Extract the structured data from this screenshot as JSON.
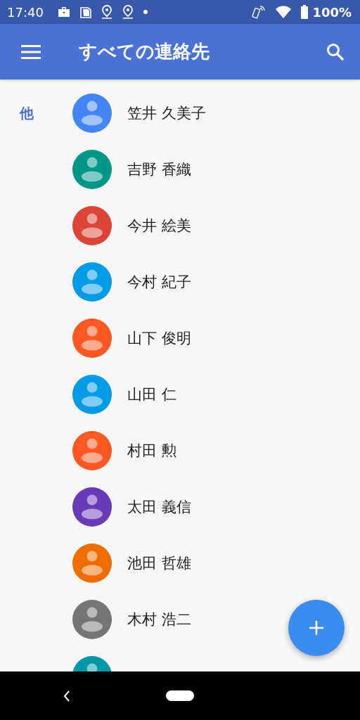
{
  "status_bar": {
    "time": "17:40",
    "battery": "100%"
  },
  "app_bar": {
    "title": "すべての連絡先"
  },
  "sections": [
    {
      "letter": "他",
      "contacts": [
        {
          "name": "笠井 久美子",
          "color": "#4285f4"
        },
        {
          "name": "吉野 香織",
          "color": "#009688"
        },
        {
          "name": "今井 絵美",
          "color": "#db4437"
        },
        {
          "name": "今村 紀子",
          "color": "#039be5"
        },
        {
          "name": "山下 俊明",
          "color": "#ff5722"
        },
        {
          "name": "山田 仁",
          "color": "#039be5"
        },
        {
          "name": "村田 勲",
          "color": "#ff5722"
        },
        {
          "name": "太田 義信",
          "color": "#673ab7"
        },
        {
          "name": "池田 哲雄",
          "color": "#ef6c00"
        },
        {
          "name": "木村 浩二",
          "color": "#757575"
        },
        {
          "color": "#0097a7"
        }
      ]
    }
  ]
}
